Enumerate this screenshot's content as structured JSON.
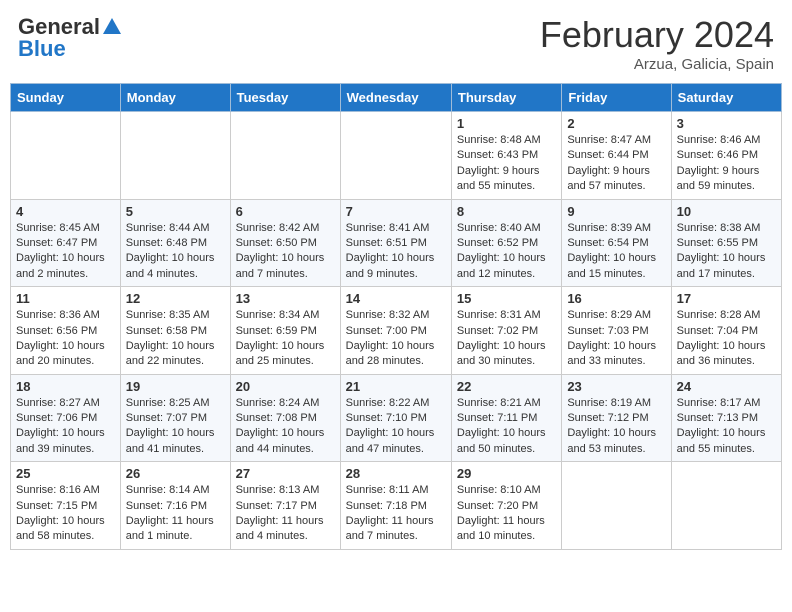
{
  "logo": {
    "general": "General",
    "blue": "Blue"
  },
  "title": {
    "month_year": "February 2024",
    "location": "Arzua, Galicia, Spain"
  },
  "days_of_week": [
    "Sunday",
    "Monday",
    "Tuesday",
    "Wednesday",
    "Thursday",
    "Friday",
    "Saturday"
  ],
  "weeks": [
    [
      {
        "day": "",
        "info": ""
      },
      {
        "day": "",
        "info": ""
      },
      {
        "day": "",
        "info": ""
      },
      {
        "day": "",
        "info": ""
      },
      {
        "day": "1",
        "info": "Sunrise: 8:48 AM\nSunset: 6:43 PM\nDaylight: 9 hours and 55 minutes."
      },
      {
        "day": "2",
        "info": "Sunrise: 8:47 AM\nSunset: 6:44 PM\nDaylight: 9 hours and 57 minutes."
      },
      {
        "day": "3",
        "info": "Sunrise: 8:46 AM\nSunset: 6:46 PM\nDaylight: 9 hours and 59 minutes."
      }
    ],
    [
      {
        "day": "4",
        "info": "Sunrise: 8:45 AM\nSunset: 6:47 PM\nDaylight: 10 hours and 2 minutes."
      },
      {
        "day": "5",
        "info": "Sunrise: 8:44 AM\nSunset: 6:48 PM\nDaylight: 10 hours and 4 minutes."
      },
      {
        "day": "6",
        "info": "Sunrise: 8:42 AM\nSunset: 6:50 PM\nDaylight: 10 hours and 7 minutes."
      },
      {
        "day": "7",
        "info": "Sunrise: 8:41 AM\nSunset: 6:51 PM\nDaylight: 10 hours and 9 minutes."
      },
      {
        "day": "8",
        "info": "Sunrise: 8:40 AM\nSunset: 6:52 PM\nDaylight: 10 hours and 12 minutes."
      },
      {
        "day": "9",
        "info": "Sunrise: 8:39 AM\nSunset: 6:54 PM\nDaylight: 10 hours and 15 minutes."
      },
      {
        "day": "10",
        "info": "Sunrise: 8:38 AM\nSunset: 6:55 PM\nDaylight: 10 hours and 17 minutes."
      }
    ],
    [
      {
        "day": "11",
        "info": "Sunrise: 8:36 AM\nSunset: 6:56 PM\nDaylight: 10 hours and 20 minutes."
      },
      {
        "day": "12",
        "info": "Sunrise: 8:35 AM\nSunset: 6:58 PM\nDaylight: 10 hours and 22 minutes."
      },
      {
        "day": "13",
        "info": "Sunrise: 8:34 AM\nSunset: 6:59 PM\nDaylight: 10 hours and 25 minutes."
      },
      {
        "day": "14",
        "info": "Sunrise: 8:32 AM\nSunset: 7:00 PM\nDaylight: 10 hours and 28 minutes."
      },
      {
        "day": "15",
        "info": "Sunrise: 8:31 AM\nSunset: 7:02 PM\nDaylight: 10 hours and 30 minutes."
      },
      {
        "day": "16",
        "info": "Sunrise: 8:29 AM\nSunset: 7:03 PM\nDaylight: 10 hours and 33 minutes."
      },
      {
        "day": "17",
        "info": "Sunrise: 8:28 AM\nSunset: 7:04 PM\nDaylight: 10 hours and 36 minutes."
      }
    ],
    [
      {
        "day": "18",
        "info": "Sunrise: 8:27 AM\nSunset: 7:06 PM\nDaylight: 10 hours and 39 minutes."
      },
      {
        "day": "19",
        "info": "Sunrise: 8:25 AM\nSunset: 7:07 PM\nDaylight: 10 hours and 41 minutes."
      },
      {
        "day": "20",
        "info": "Sunrise: 8:24 AM\nSunset: 7:08 PM\nDaylight: 10 hours and 44 minutes."
      },
      {
        "day": "21",
        "info": "Sunrise: 8:22 AM\nSunset: 7:10 PM\nDaylight: 10 hours and 47 minutes."
      },
      {
        "day": "22",
        "info": "Sunrise: 8:21 AM\nSunset: 7:11 PM\nDaylight: 10 hours and 50 minutes."
      },
      {
        "day": "23",
        "info": "Sunrise: 8:19 AM\nSunset: 7:12 PM\nDaylight: 10 hours and 53 minutes."
      },
      {
        "day": "24",
        "info": "Sunrise: 8:17 AM\nSunset: 7:13 PM\nDaylight: 10 hours and 55 minutes."
      }
    ],
    [
      {
        "day": "25",
        "info": "Sunrise: 8:16 AM\nSunset: 7:15 PM\nDaylight: 10 hours and 58 minutes."
      },
      {
        "day": "26",
        "info": "Sunrise: 8:14 AM\nSunset: 7:16 PM\nDaylight: 11 hours and 1 minute."
      },
      {
        "day": "27",
        "info": "Sunrise: 8:13 AM\nSunset: 7:17 PM\nDaylight: 11 hours and 4 minutes."
      },
      {
        "day": "28",
        "info": "Sunrise: 8:11 AM\nSunset: 7:18 PM\nDaylight: 11 hours and 7 minutes."
      },
      {
        "day": "29",
        "info": "Sunrise: 8:10 AM\nSunset: 7:20 PM\nDaylight: 11 hours and 10 minutes."
      },
      {
        "day": "",
        "info": ""
      },
      {
        "day": "",
        "info": ""
      }
    ]
  ]
}
